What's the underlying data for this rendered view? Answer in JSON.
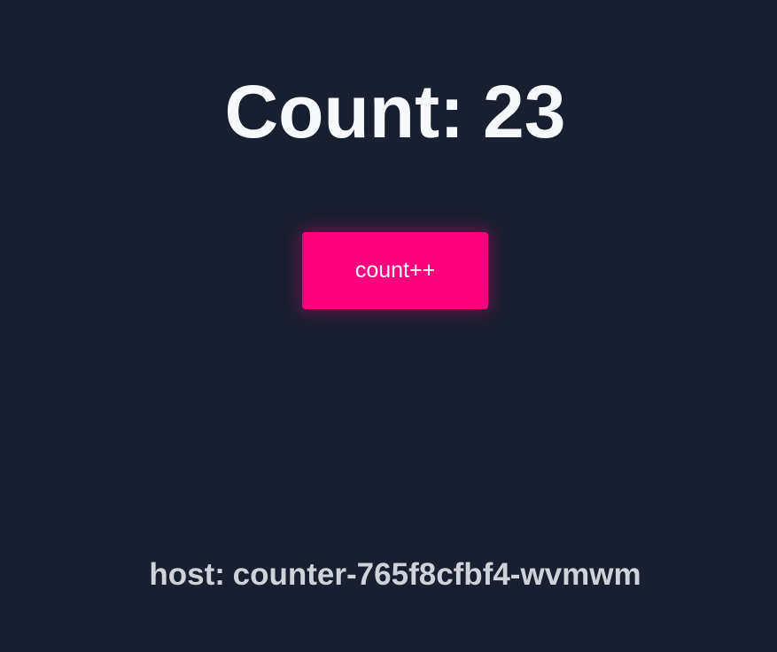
{
  "counter": {
    "label": "Count:",
    "value": "23"
  },
  "button": {
    "label": "count++"
  },
  "host": {
    "label": "host:",
    "value": "counter-765f8cfbf4-wvmwm"
  },
  "colors": {
    "background": "#181f2e",
    "accent": "#ff007f",
    "title_text": "#f7f8fa",
    "host_text": "#cfd3d9"
  }
}
